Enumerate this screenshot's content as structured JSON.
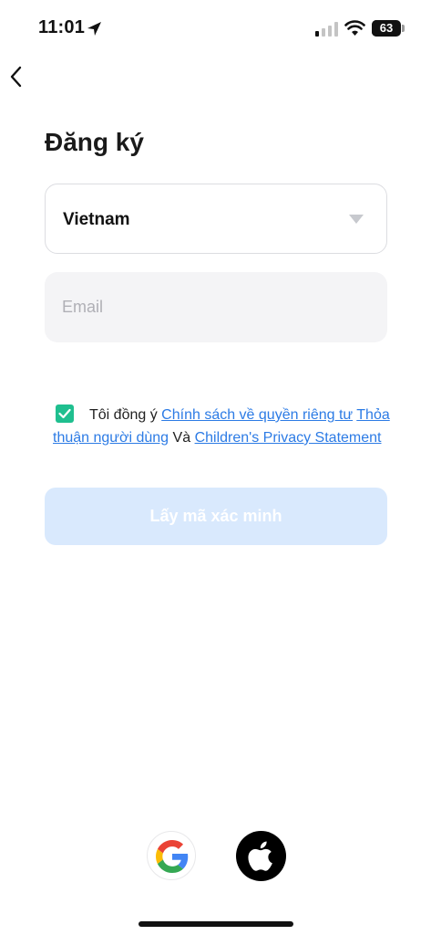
{
  "status_bar": {
    "time": "11:01",
    "battery_level": "63",
    "battery_fraction": 0.63,
    "icons": [
      "location-arrow-icon",
      "cellular-signal-icon",
      "wifi-icon",
      "battery-icon"
    ]
  },
  "nav": {
    "back_icon": "chevron-left-icon"
  },
  "page": {
    "title": "Đăng ký"
  },
  "form": {
    "country": {
      "value": "Vietnam",
      "icon": "caret-down-icon"
    },
    "email": {
      "value": "",
      "placeholder": "Email"
    },
    "agreement": {
      "checked": true,
      "prefix": "Tôi đồng ý",
      "link_privacy": "Chính sách về quyền riêng tư",
      "link_terms": "Thỏa thuận người dùng",
      "conjunction": "Và",
      "link_children": "Children's Privacy Statement"
    },
    "submit_label": "Lấy mã xác minh"
  },
  "social_login": [
    {
      "id": "google",
      "icon": "google-logo-icon"
    },
    {
      "id": "apple",
      "icon": "apple-logo-icon"
    }
  ],
  "colors": {
    "accent": "#1FBF8F",
    "link": "#2C7BE5",
    "submit_disabled_bg": "#D9E9FD",
    "input_bg": "#F4F4F6"
  }
}
